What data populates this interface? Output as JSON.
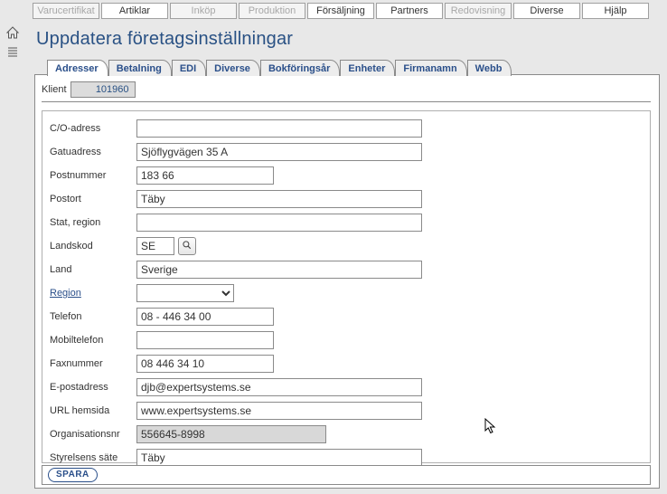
{
  "main_menu": [
    {
      "label": "Varucertifikat",
      "disabled": true
    },
    {
      "label": "Artiklar",
      "disabled": false
    },
    {
      "label": "Inköp",
      "disabled": true
    },
    {
      "label": "Produktion",
      "disabled": true
    },
    {
      "label": "Försäljning",
      "disabled": false
    },
    {
      "label": "Partners",
      "disabled": false
    },
    {
      "label": "Redovisning",
      "disabled": true
    },
    {
      "label": "Diverse",
      "disabled": false
    },
    {
      "label": "Hjälp",
      "disabled": false
    }
  ],
  "page_title": "Uppdatera företagsinställningar",
  "tabs": [
    {
      "label": "Adresser",
      "active": true
    },
    {
      "label": "Betalning",
      "active": false
    },
    {
      "label": "EDI",
      "active": false
    },
    {
      "label": "Diverse",
      "active": false
    },
    {
      "label": "Bokföringsår",
      "active": false
    },
    {
      "label": "Enheter",
      "active": false
    },
    {
      "label": "Firmanamn",
      "active": false
    },
    {
      "label": "Webb",
      "active": false
    }
  ],
  "klient": {
    "label": "Klient",
    "value": "101960"
  },
  "fields": {
    "co": {
      "label": "C/O-adress",
      "value": ""
    },
    "street": {
      "label": "Gatuadress",
      "value": "Sjöflygvägen 35 A"
    },
    "zip": {
      "label": "Postnummer",
      "value": "183 66"
    },
    "city": {
      "label": "Postort",
      "value": "Täby"
    },
    "state": {
      "label": "Stat, region",
      "value": ""
    },
    "ccode": {
      "label": "Landskod",
      "value": "SE"
    },
    "country": {
      "label": "Land",
      "value": "Sverige"
    },
    "region": {
      "label": "Region",
      "value": ""
    },
    "phone": {
      "label": "Telefon",
      "value": "08 - 446 34 00"
    },
    "mobile": {
      "label": "Mobiltelefon",
      "value": ""
    },
    "fax": {
      "label": "Faxnummer",
      "value": "08 446 34 10"
    },
    "email": {
      "label": "E-postadress",
      "value": "djb@expertsystems.se"
    },
    "url": {
      "label": "URL hemsida",
      "value": "www.expertsystems.se"
    },
    "orgnr": {
      "label": "Organisationsnr",
      "value": "556645-8998"
    },
    "seat": {
      "label": "Styrelsens säte",
      "value": "Täby"
    }
  },
  "save_label": "SPARA"
}
